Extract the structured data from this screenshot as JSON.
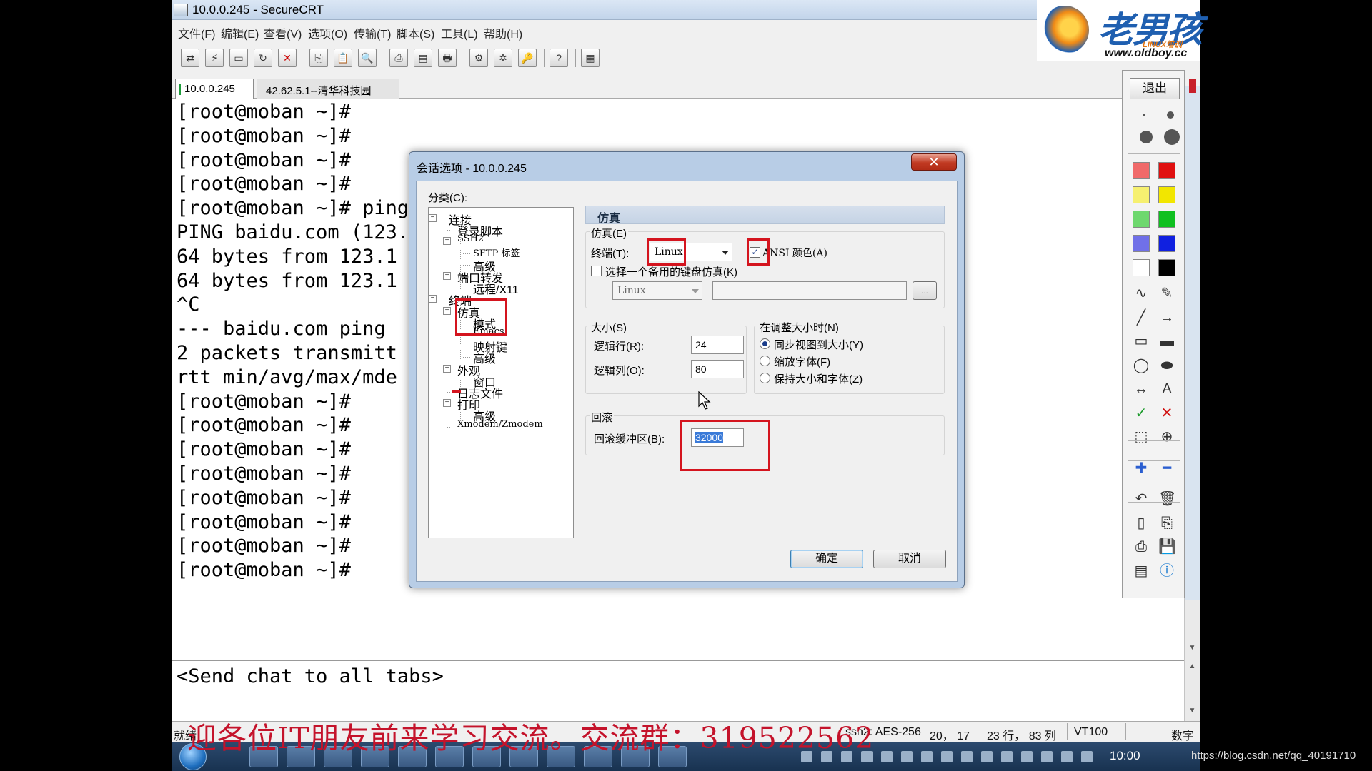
{
  "window": {
    "title": "10.0.0.245 - SecureCRT"
  },
  "menu": {
    "items": [
      "文件(F)",
      "编辑(E)",
      "查看(V)",
      "选项(O)",
      "传输(T)",
      "脚本(S)",
      "工具(L)",
      "帮助(H)"
    ]
  },
  "tabs": [
    {
      "label": "10.0.0.245",
      "active": true
    },
    {
      "label": "42.62.5.1--清华科技园",
      "active": false
    }
  ],
  "terminal": {
    "lines": [
      "[root@moban ~]#",
      "[root@moban ~]#",
      "[root@moban ~]#",
      "[root@moban ~]#",
      "[root@moban ~]# ping",
      "PING baidu.com (123.",
      "64 bytes from 123.1",
      "64 bytes from 123.1",
      "^C",
      "--- baidu.com ping",
      "2 packets transmitt",
      "rtt min/avg/max/mde",
      "[root@moban ~]#",
      "[root@moban ~]#",
      "[root@moban ~]#",
      "[root@moban ~]#",
      "[root@moban ~]#",
      "[root@moban ~]#",
      "[root@moban ~]#",
      "[root@moban ~]#"
    ]
  },
  "chat": {
    "text": "<Send chat to all tabs>"
  },
  "statusbar": {
    "ready": "就绪",
    "cipher": "ssh2: AES-256",
    "position": "20， 17",
    "size": "23 行， 83 列",
    "emulation": "VT100",
    "numlock": "数字"
  },
  "overlay": {
    "text": "迎各位IT朋友前来学习交流。交流群：319522562"
  },
  "logo": {
    "text": "老男孩",
    "sub": "LINUX培训",
    "url": "www.oldboy.cc"
  },
  "pen_panel": {
    "exit_label": "退出",
    "colors": [
      "#f06a6a",
      "#e01010",
      "#f6f070",
      "#f2e600",
      "#6ed86e",
      "#10c020",
      "#7070e8",
      "#1020e0",
      "#ffffff",
      "#000000"
    ],
    "tools": [
      "freehand-icon",
      "highlighter-icon",
      "line-icon",
      "arrow-icon",
      "rectangle-icon",
      "filled-rectangle-icon",
      "ellipse-icon",
      "filled-ellipse-icon",
      "double-arrow-icon",
      "text-icon",
      "check-icon",
      "cross-icon",
      "crop-icon",
      "zoom-icon",
      "plus-icon",
      "minus-icon",
      "undo-icon",
      "trash-icon",
      "new-page-icon",
      "copy-icon",
      "print-icon",
      "save-icon",
      "screen-icon",
      "info-icon"
    ]
  },
  "dialog": {
    "title": "会话选项 - 10.0.0.245",
    "category_label": "分类(C):",
    "tree": [
      {
        "label": "连接",
        "level": 0
      },
      {
        "label": "登录脚本",
        "level": 1
      },
      {
        "label": "SSH2",
        "level": 1
      },
      {
        "label": "SFTP 标签",
        "level": 2
      },
      {
        "label": "高级",
        "level": 2
      },
      {
        "label": "端口转发",
        "level": 1
      },
      {
        "label": "远程/X11",
        "level": 2
      },
      {
        "label": "终端",
        "level": 0
      },
      {
        "label": "仿真",
        "level": 1
      },
      {
        "label": "模式",
        "level": 2
      },
      {
        "label": "Emacs",
        "level": 2
      },
      {
        "label": "映射键",
        "level": 2
      },
      {
        "label": "高级",
        "level": 2
      },
      {
        "label": "外观",
        "level": 1
      },
      {
        "label": "窗口",
        "level": 2
      },
      {
        "label": "日志文件",
        "level": 1
      },
      {
        "label": "打印",
        "level": 1
      },
      {
        "label": "高级",
        "level": 2
      },
      {
        "label": "Xmodem/Zmodem",
        "level": 1
      }
    ],
    "section_title": "仿真",
    "emulation_group": "仿真(E)",
    "terminal_label": "终端(T):",
    "terminal_value": "Linux",
    "ansi_label": "ANSI 颜色(A)",
    "ansi_checked": true,
    "alt_keyboard_label": "选择一个备用的键盘仿真(K)",
    "alt_keyboard_checked": false,
    "alt_keyboard_value": "Linux",
    "browse_label": "...",
    "size_group": "大小(S)",
    "rows_label": "逻辑行(R):",
    "rows_value": "24",
    "cols_label": "逻辑列(O):",
    "cols_value": "80",
    "resize_group": "在调整大小时(N)",
    "resize_options": [
      {
        "label": "同步视图到大小(Y)",
        "selected": true
      },
      {
        "label": "缩放字体(F)",
        "selected": false
      },
      {
        "label": "保持大小和字体(Z)",
        "selected": false
      }
    ],
    "scroll_group": "回滚",
    "scroll_label": "回滚缓冲区(B):",
    "scroll_value": "32000",
    "ok_label": "确定",
    "cancel_label": "取消"
  },
  "taskbar": {
    "clock": "10:00",
    "source_note": "https://blog.csdn.net/qq_40191710"
  }
}
